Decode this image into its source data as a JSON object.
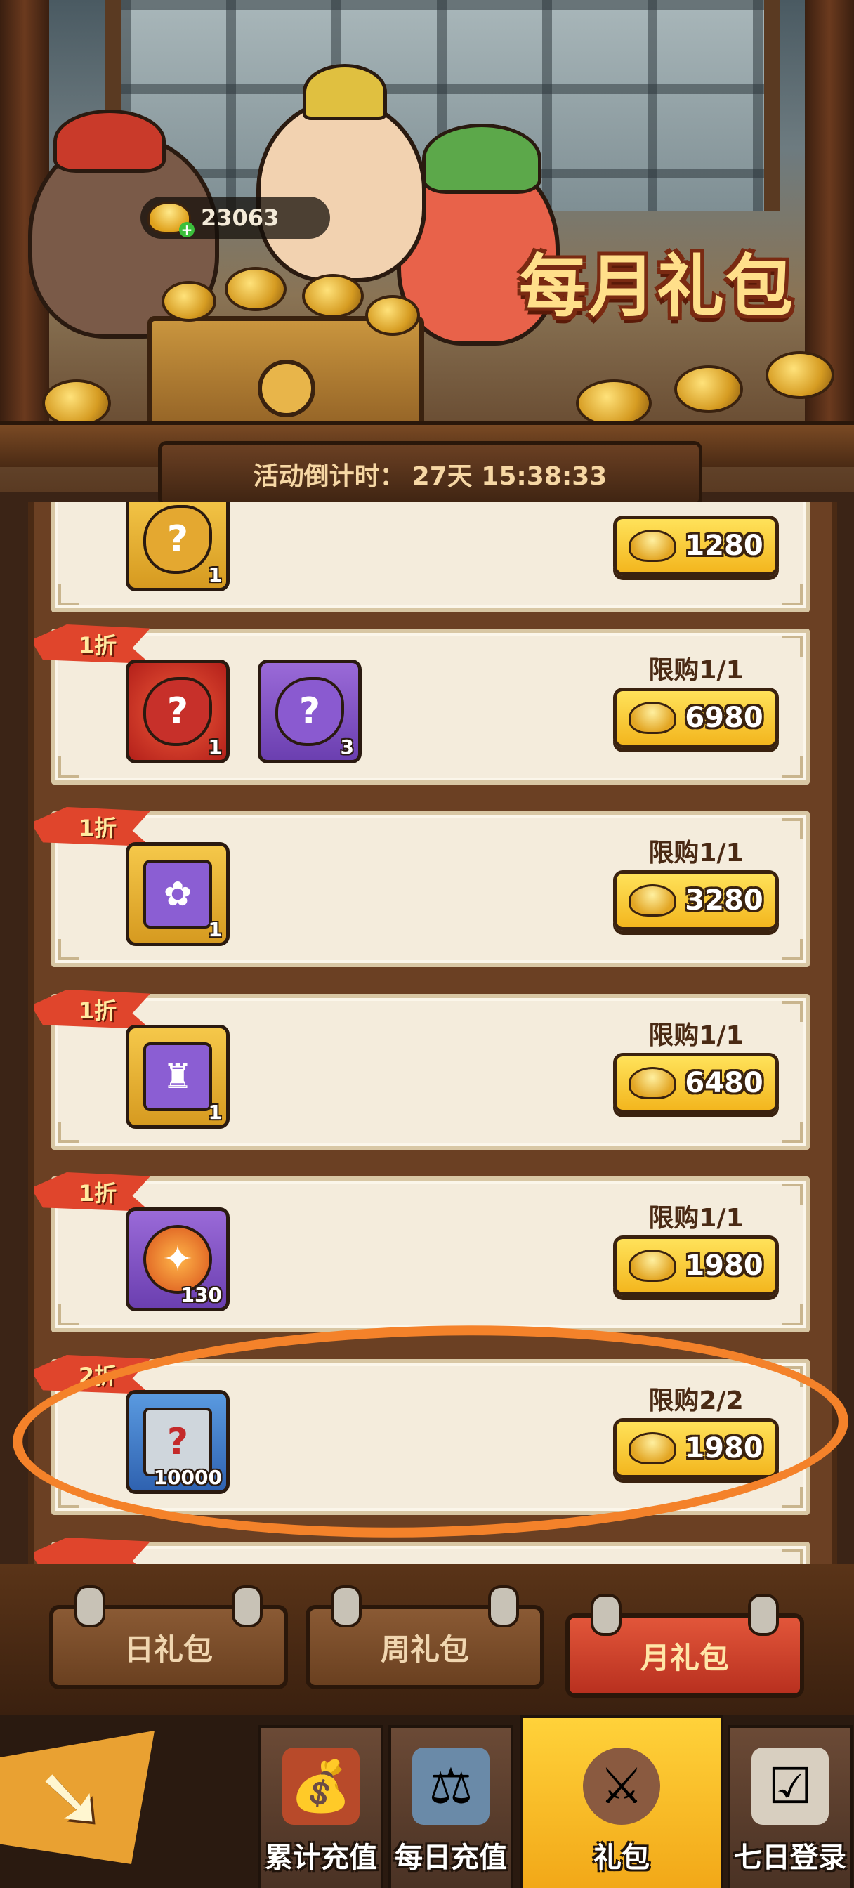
{
  "banner": {
    "currency_amount": "23063",
    "title": "每月礼包",
    "countdown_label": "活动倒计时：",
    "countdown_value": "27天 15:38:33"
  },
  "offers": [
    {
      "discount": "",
      "items": [
        {
          "icon": "fragment-icon",
          "qty": "1"
        }
      ],
      "limit": "",
      "price": "1280"
    },
    {
      "discount": "1折",
      "items": [
        {
          "icon": "red-fragment-icon",
          "qty": "1"
        },
        {
          "icon": "purple-fragment-icon",
          "qty": "3"
        }
      ],
      "limit": "限购1/1",
      "price": "6980"
    },
    {
      "discount": "1折",
      "items": [
        {
          "icon": "chest-fan-icon",
          "qty": "1"
        }
      ],
      "limit": "限购1/1",
      "price": "3280"
    },
    {
      "discount": "1折",
      "items": [
        {
          "icon": "chest-hero-icon",
          "qty": "1"
        }
      ],
      "limit": "限购1/1",
      "price": "6480"
    },
    {
      "discount": "1折",
      "items": [
        {
          "icon": "fire-orb-icon",
          "qty": "130"
        }
      ],
      "limit": "限购1/1",
      "price": "1980"
    },
    {
      "discount": "2折",
      "items": [
        {
          "icon": "scroll-icon",
          "qty": "10000"
        }
      ],
      "limit": "限购2/2",
      "price": "1980"
    }
  ],
  "gift_tabs": [
    {
      "label": "日礼包",
      "active": false
    },
    {
      "label": "周礼包",
      "active": false
    },
    {
      "label": "月礼包",
      "active": true
    }
  ],
  "bottom_nav": [
    {
      "label": "累计充值",
      "icon": "treasure-bag-icon",
      "active": false
    },
    {
      "label": "每日充值",
      "icon": "scale-icon",
      "active": false
    },
    {
      "label": "礼包",
      "icon": "crossed-swords-icon",
      "active": true
    },
    {
      "label": "七日登录",
      "icon": "checklist-icon",
      "active": false
    }
  ],
  "colors": {
    "accent_gold": "#f3b61e",
    "discount_red": "#e0452c",
    "highlight_orange": "#f4822a",
    "panel_bg": "#f4ecdc"
  }
}
